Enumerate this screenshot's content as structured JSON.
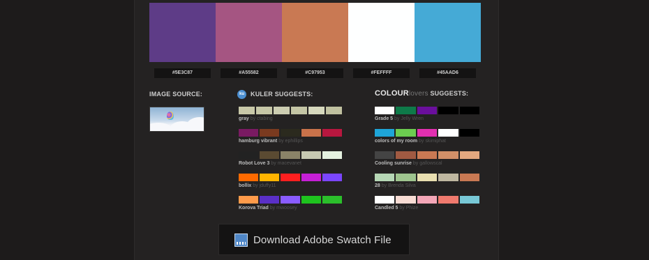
{
  "palette": [
    {
      "hex": "#5E3C87",
      "color": "#5E3C87"
    },
    {
      "hex": "#A55582",
      "color": "#A55582"
    },
    {
      "hex": "#C97953",
      "color": "#C97953"
    },
    {
      "hex": "#FEFFFF",
      "color": "#FEFFFF"
    },
    {
      "hex": "#45AAD6",
      "color": "#45AAD6"
    }
  ],
  "image_source": {
    "title": "IMAGE SOURCE:"
  },
  "kuler": {
    "title": "KULER SUGGESTS:",
    "badge": "ku",
    "palettes": [
      {
        "name": "gray",
        "by": "by",
        "author": "ctabing",
        "colors": [
          "#c8c8a8",
          "#c6c7a7",
          "#cccdb1",
          "#c4c5a5",
          "#d6d8bd",
          "#c0c1a0"
        ]
      },
      {
        "name": "hamburg vibrant",
        "by": "by",
        "author": "ephillips",
        "colors": [
          "#7a1a62",
          "#7a3a1f",
          "#2b2a1e",
          "#c9724a",
          "#b8173f"
        ]
      },
      {
        "name": "Robot Love 3",
        "by": "by",
        "author": "macevanet",
        "colors": [
          "#222222",
          "#5a4a32",
          "#8a8368",
          "#c7c9b2",
          "#e5f2e0"
        ]
      },
      {
        "name": "bollix",
        "by": "by",
        "author": "jduffy11",
        "colors": [
          "#ff6a00",
          "#ffb400",
          "#ff1f1f",
          "#c61fd6",
          "#7b46ff"
        ]
      },
      {
        "name": "Korova Triad",
        "by": "by",
        "author": "mwoosey",
        "colors": [
          "#ff9b4a",
          "#5a2fc7",
          "#8a5cff",
          "#1ec31e",
          "#2bbf2b"
        ]
      }
    ]
  },
  "colourlovers": {
    "title_brand": "COLOUR",
    "title_lovers": "lovers",
    "title_rest": " SUGGESTS:",
    "palettes": [
      {
        "name": "Grade 5",
        "by": "by",
        "author": "Jelly Wren",
        "colors": [
          "#ffffff",
          "#0e7a49",
          "#6a0f9c",
          "#000000",
          "#000000"
        ]
      },
      {
        "name": "colors of my room",
        "by": "by",
        "author": "skimiphat",
        "colors": [
          "#1ea5d8",
          "#6ccc50",
          "#e22fb0",
          "#ffffff",
          "#000000"
        ]
      },
      {
        "name": "Cooling sunrise",
        "by": "by",
        "author": "gallowscal",
        "colors": [
          "#444444",
          "#a05a42",
          "#c97953",
          "#d29068",
          "#e3a87f"
        ]
      },
      {
        "name": "28",
        "by": "by",
        "author": "Brenda Silva",
        "colors": [
          "#b6d7b5",
          "#9fc58f",
          "#e9dfb0",
          "#bfb7a0",
          "#c97953"
        ]
      },
      {
        "name": "Candled 5",
        "by": "by",
        "author": "Phize",
        "colors": [
          "#ffffff",
          "#f8dcd4",
          "#f3a6b7",
          "#f07a6e",
          "#78c8d6"
        ]
      }
    ]
  },
  "download": {
    "label": "Download Adobe Swatch File"
  }
}
